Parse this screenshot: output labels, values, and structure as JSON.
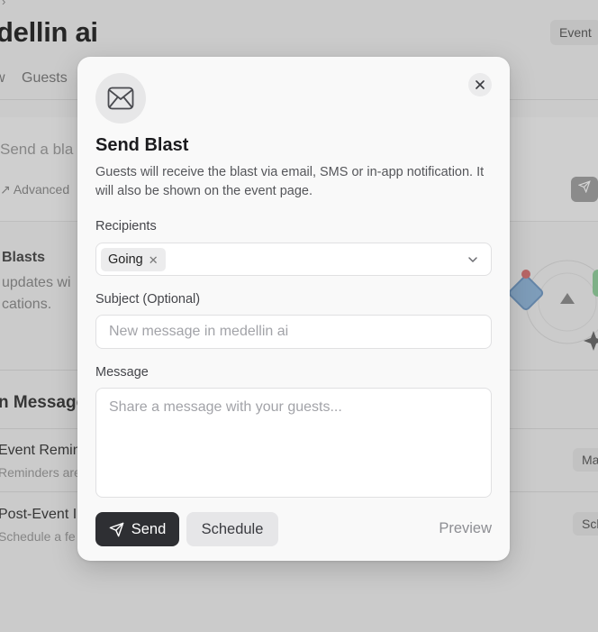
{
  "background": {
    "breadcrumb_glyph": "›",
    "event_title": "dellin ai",
    "event_button": "Event",
    "tabs": [
      "w",
      "Guests"
    ],
    "compose_placeholder": "Send a bla",
    "advanced_label": "↗ Advanced",
    "blasts_title": "Blasts",
    "blasts_desc_line1": "updates wi",
    "blasts_desc_line2": "cations.",
    "section_title": "n Message",
    "rows": [
      {
        "title": "Event Remin",
        "subtitle": "Reminders are",
        "button": "Ma"
      },
      {
        "title": "Post-Event I",
        "subtitle": "Schedule a fe",
        "button": "Sch"
      }
    ]
  },
  "modal": {
    "icon": "envelope-icon",
    "title": "Send Blast",
    "description": "Guests will receive the blast via email, SMS or in-app notification. It will also be shown on the event page.",
    "recipients": {
      "label": "Recipients",
      "selected": [
        "Going"
      ],
      "chip_remove_glyph": "✕"
    },
    "subject": {
      "label": "Subject (Optional)",
      "value": "",
      "placeholder": "New message in medellin ai"
    },
    "message": {
      "label": "Message",
      "value": "",
      "placeholder": "Share a message with your guests..."
    },
    "actions": {
      "send_label": "Send",
      "schedule_label": "Schedule",
      "preview_label": "Preview"
    }
  },
  "colors": {
    "primary_button": "#2e2f33",
    "secondary_button": "#e6e6e8",
    "modal_background": "#f9f9f9"
  }
}
